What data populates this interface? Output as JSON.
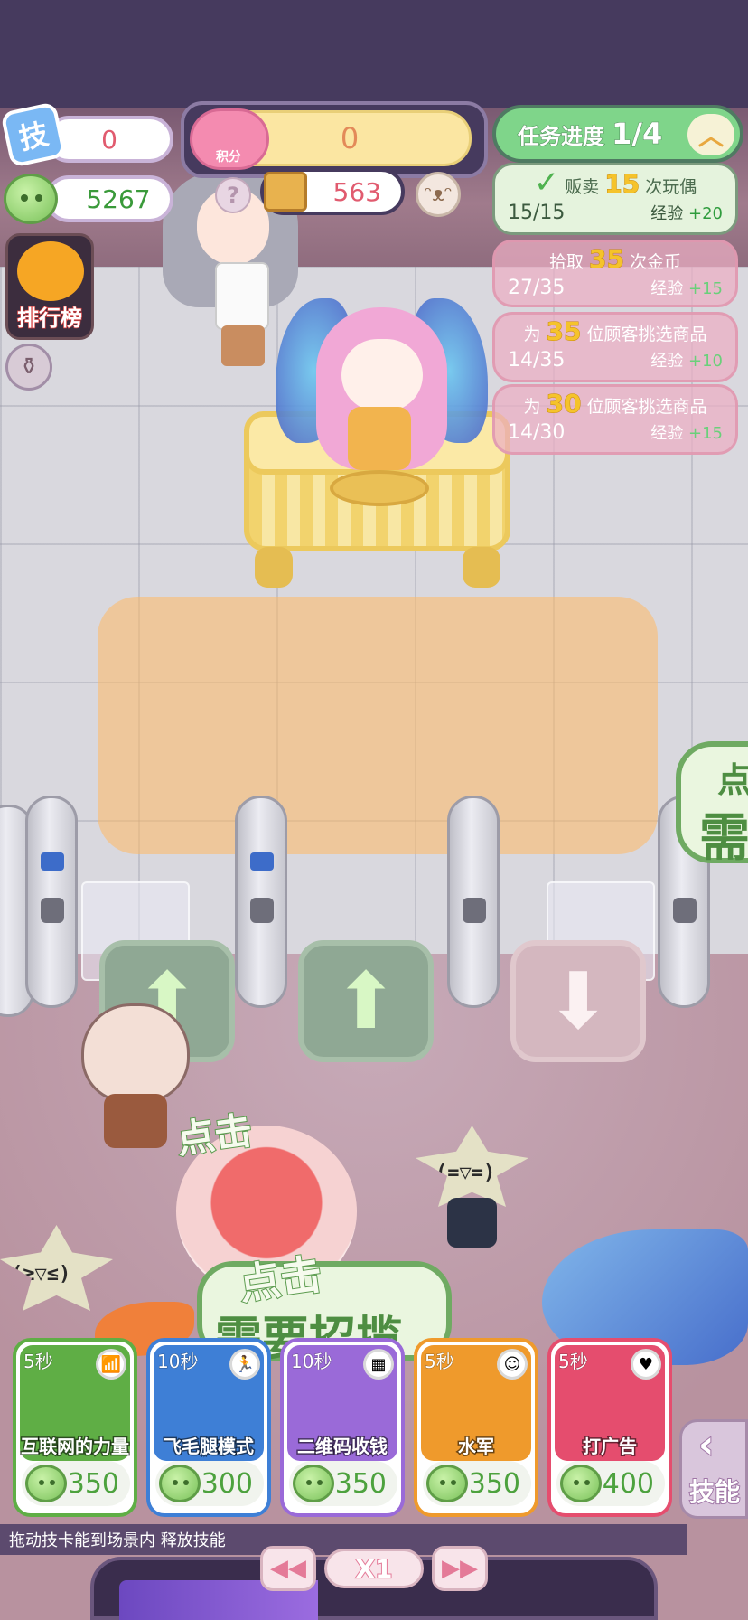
{
  "hud": {
    "skill_badge_label": "技",
    "skill_points": "0",
    "seeds": "5267",
    "ranking_label": "排行榜",
    "bottle_icon": "bottle-icon",
    "score_label": "积分",
    "score_value": "0",
    "help_label": "?",
    "boxes": "563",
    "mascot_icon": "mascot-icon"
  },
  "tasks": {
    "header_title": "任务进度",
    "header_progress": "1/4",
    "collapse_icon": "chevron-up-icon",
    "items": [
      {
        "prefix": "贩卖",
        "num": "15",
        "suffix": "次玩偶",
        "count": "15/15",
        "xp_label": "经验",
        "xp_value": "+20",
        "done": true
      },
      {
        "prefix": "拾取",
        "num": "35",
        "suffix": "次金币",
        "count": "27/35",
        "xp_label": "经验",
        "xp_value": "+15",
        "done": false
      },
      {
        "prefix": "为",
        "num": "35",
        "suffix": "位顾客挑选商品",
        "count": "14/35",
        "xp_label": "经验",
        "xp_value": "+10",
        "done": false
      },
      {
        "prefix": "为",
        "num": "30",
        "suffix": "位顾客挑选商品",
        "count": "14/30",
        "xp_label": "经验",
        "xp_value": "+15",
        "done": false
      }
    ]
  },
  "scene": {
    "customer1_face": "",
    "customer2_face": "(=▽=)",
    "customer3_face": "(≥▽≤)",
    "tap_small": "点击",
    "tap_big": "点击",
    "need_text": "需要招揽",
    "right_bubble_line1": "点",
    "right_bubble_line2": "需"
  },
  "skills": [
    {
      "timer": "5秒",
      "name": "互联网的力量",
      "cost": "350",
      "color": "#5fae45",
      "icon": "wifi-icon"
    },
    {
      "timer": "10秒",
      "name": "飞毛腿模式",
      "cost": "300",
      "color": "#3e7fd6",
      "icon": "running-icon"
    },
    {
      "timer": "10秒",
      "name": "二维码收钱",
      "cost": "350",
      "color": "#9a6ad8",
      "icon": "qr-icon"
    },
    {
      "timer": "5秒",
      "name": "水军",
      "cost": "350",
      "color": "#ef9a2c",
      "icon": "crowd-icon"
    },
    {
      "timer": "5秒",
      "name": "打广告",
      "cost": "400",
      "color": "#e54d6e",
      "icon": "megaphone-icon"
    }
  ],
  "skill_toggle": {
    "label": "技能",
    "chevron": "‹"
  },
  "hint": "拖动技卡能到场景内  释放技能",
  "speed": {
    "rewind": "◀◀",
    "value": "X1",
    "forward": "▶▶"
  }
}
